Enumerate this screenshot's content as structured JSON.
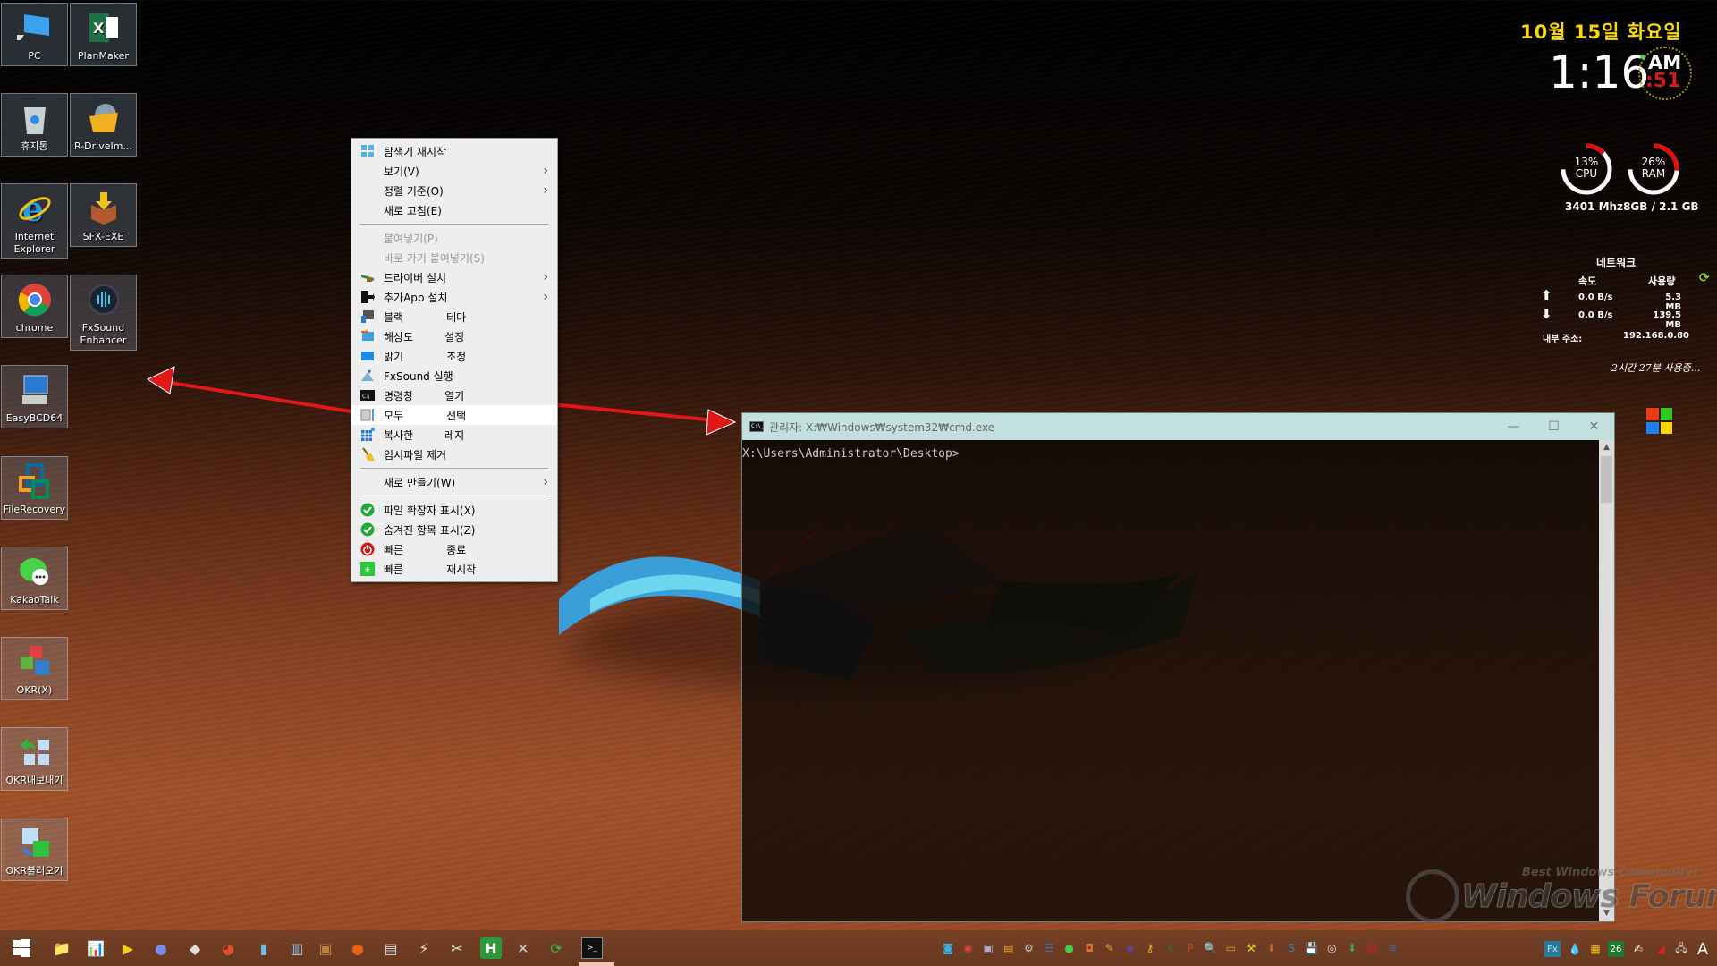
{
  "desktop_icons": [
    {
      "label": "PC",
      "icon": "computer-icon"
    },
    {
      "label": "PlanMaker",
      "icon": "spreadsheet-icon"
    },
    {
      "label": "휴지통",
      "icon": "recycle-bin-icon"
    },
    {
      "label": "R-DriveIm...",
      "icon": "disk-folder-icon"
    },
    {
      "label": "Internet Explorer",
      "icon": "internet-explorer-icon"
    },
    {
      "label": "SFX-EXE",
      "icon": "package-box-icon"
    },
    {
      "label": "chrome",
      "icon": "chrome-icon"
    },
    {
      "label": "FxSound Enhancer",
      "icon": "fxsound-icon"
    },
    {
      "label": "EasyBCD64",
      "icon": "easybcd-icon"
    },
    {
      "label": "FileRecovery",
      "icon": "file-recovery-icon"
    },
    {
      "label": "KakaoTalk",
      "icon": "kakaotalk-icon"
    },
    {
      "label": "OKR(X)",
      "icon": "okr-cubes-icon"
    },
    {
      "label": "OKR내보내기",
      "icon": "okr-export-icon"
    },
    {
      "label": "OKR불러오기",
      "icon": "okr-import-icon"
    }
  ],
  "context_menu": {
    "items": [
      {
        "label": "탐색기 재시작",
        "icon": "explorer-grid-icon",
        "submenu": false,
        "disabled": false
      },
      {
        "label": "보기(V)",
        "icon": "",
        "submenu": true,
        "disabled": false
      },
      {
        "label": "정렬 기준(O)",
        "icon": "",
        "submenu": true,
        "disabled": false
      },
      {
        "label": "새로 고침(E)",
        "icon": "",
        "submenu": false,
        "disabled": false
      },
      {
        "sep": true
      },
      {
        "label": "붙여넣기(P)",
        "icon": "",
        "submenu": false,
        "disabled": true
      },
      {
        "label": "바로 가기 붙여넣기(S)",
        "icon": "",
        "submenu": false,
        "disabled": true
      },
      {
        "label": "드라이버 설치",
        "icon": "driver-icon",
        "submenu": true,
        "disabled": false
      },
      {
        "label": "추가App 설치",
        "icon": "app-install-icon",
        "submenu": true,
        "disabled": false
      },
      {
        "label": "블랙",
        "label2": "테마",
        "icon": "theme-icon",
        "submenu": false,
        "disabled": false
      },
      {
        "label": "해상도",
        "label2": "설정",
        "icon": "resolution-icon",
        "submenu": false,
        "disabled": false
      },
      {
        "label": "밝기",
        "label2": "조정",
        "icon": "brightness-icon",
        "submenu": false,
        "disabled": false
      },
      {
        "label": "FxSound 실행",
        "icon": "fxsound-small-icon",
        "submenu": false,
        "disabled": false
      },
      {
        "label": "명령창",
        "label2": "열기",
        "icon": "cmd-icon",
        "submenu": false,
        "disabled": false
      },
      {
        "label": "모두",
        "label2": "선택",
        "icon": "select-all-icon",
        "submenu": false,
        "disabled": false,
        "hover": true
      },
      {
        "label": "복사한",
        "label2": "레지",
        "icon": "registry-icon",
        "submenu": false,
        "disabled": false
      },
      {
        "label": "임시파일 제거",
        "icon": "broom-icon",
        "submenu": false,
        "disabled": false
      },
      {
        "sep": true
      },
      {
        "label": "새로 만들기(W)",
        "icon": "",
        "submenu": true,
        "disabled": false
      },
      {
        "sep": true
      },
      {
        "label": "파일 확장자 표시(X)",
        "icon": "check-icon",
        "submenu": false,
        "disabled": false
      },
      {
        "label": "숨겨진 항목 표시(Z)",
        "icon": "check-icon",
        "submenu": false,
        "disabled": false
      },
      {
        "label": "빠른",
        "label2": "종료",
        "icon": "power-icon",
        "submenu": false,
        "disabled": false
      },
      {
        "label": "빠른",
        "label2": "재시작",
        "icon": "restart-icon",
        "submenu": false,
        "disabled": false
      }
    ]
  },
  "clock": {
    "date": "10월 15일 화요일",
    "time": "1:16",
    "ampm": "AM",
    "seconds": ":51"
  },
  "system": {
    "cpu": {
      "percent": 13,
      "label": "CPU",
      "display": "13%"
    },
    "ram": {
      "percent": 26,
      "label": "RAM",
      "display": "26%"
    },
    "info": "3401 Mhz8GB /  2.1 GB",
    "gauge_color": "#e01010"
  },
  "network": {
    "title": "네트워크",
    "col_speed": "속도",
    "col_usage": "사용량",
    "upload_speed": "0.0 B/s",
    "upload_usage": "5.3 MB",
    "download_speed": "0.0 B/s",
    "download_usage": "139.5 MB",
    "ip_label": "내부 주소:",
    "ip": "192.168.0.80"
  },
  "uptime": "2시간 27분 사용중...",
  "cmd_window": {
    "title": "관리자: X:₩Windows₩system32₩cmd.exe",
    "icon_text": "C:\\_",
    "prompt": "X:\\Users\\Administrator\\Desktop>",
    "minimize": "—",
    "maximize": "☐",
    "close": "✕"
  },
  "watermark": {
    "tagline": "Best Windows Community!",
    "name": "Windows Forum"
  },
  "taskbar": {
    "pinned": [
      "start-button",
      "file-explorer-icon",
      "system-monitor-icon",
      "player-icon",
      "media-disc-icon",
      "floppy-tool-icon",
      "browser-check-icon",
      "notebook-icon",
      "pc-setup-icon",
      "installer-box-icon",
      "orange-ball-icon",
      "disk-drive-icon",
      "flash-tool-icon",
      "remote-tools-icon",
      "h-app-icon",
      "tools-icon",
      "refresh-green-icon",
      "cmd-taskbar-icon"
    ],
    "quicklaunch": [
      "app-blue-icon",
      "chrome-small-icon",
      "pc-network-icon",
      "copy-windows-icon",
      "driver-car-icon",
      "usb-boot-icon",
      "kakao-small-icon",
      "app-orange-icon",
      "edit-pen-icon",
      "bird-icon",
      "key-icon",
      "excel-icon",
      "powerpoint-icon",
      "search-tool-icon",
      "drawer-icon",
      "hammer-icon",
      "unpack-icon",
      "sync-blue-icon",
      "save-disk-icon",
      "cd-icon",
      "install-green-icon",
      "shield-red-icon",
      "signal-icon"
    ],
    "tray": {
      "fx_label": "Fx",
      "calendar_day": "26",
      "ime": "A"
    }
  }
}
